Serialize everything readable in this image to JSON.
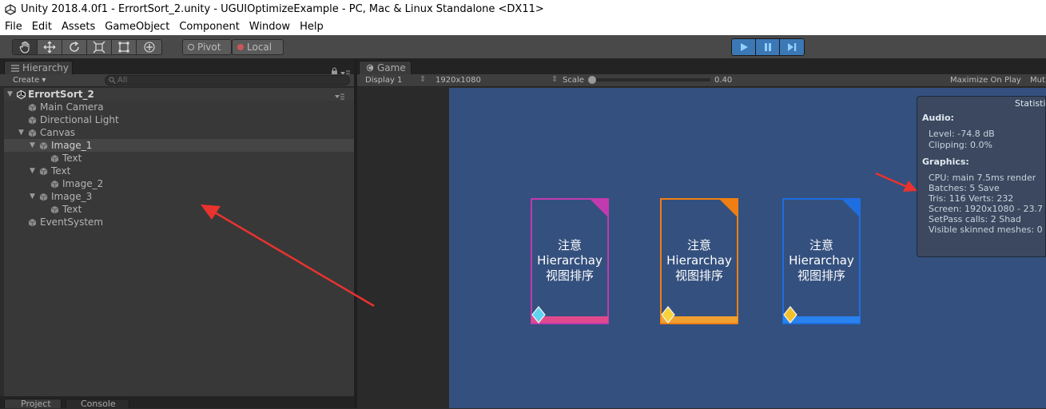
{
  "window": {
    "title": "Unity 2018.4.0f1 - ErrortSort_2.unity - UGUIOptimizeExample - PC, Mac & Linux Standalone <DX11>"
  },
  "menu": [
    "File",
    "Edit",
    "Assets",
    "GameObject",
    "Component",
    "Window",
    "Help"
  ],
  "toolbar": {
    "pivot_label": "Pivot",
    "local_label": "Local"
  },
  "hierarchy": {
    "tab_label": "Hierarchy",
    "create_label": "Create ▾",
    "search_placeholder": "All",
    "scene_name": "ErrortSort_2",
    "items": [
      {
        "label": "Main Camera"
      },
      {
        "label": "Directional Light"
      },
      {
        "label": "Canvas"
      },
      {
        "label": "Image_1"
      },
      {
        "label": "Text"
      },
      {
        "label": "Text"
      },
      {
        "label": "Image_2"
      },
      {
        "label": "Image_3"
      },
      {
        "label": "Text"
      },
      {
        "label": "EventSystem"
      }
    ],
    "bottom_tabs": [
      "Project",
      "Console"
    ]
  },
  "game": {
    "tab_label": "Game",
    "display": "Display 1",
    "resolution": "1920x1080",
    "scale_label": "Scale",
    "scale_value": "0.40",
    "maximize_label": "Maximize On Play",
    "mute_label": "Mut"
  },
  "cards": [
    {
      "line1": "注意",
      "line2": "Hierarchay",
      "line3": "视图排序",
      "accent": "#c23ab0",
      "bottom": "#e04a8c"
    },
    {
      "line1": "注意",
      "line2": "Hierarchay",
      "line3": "视图排序",
      "accent": "#f07f13",
      "bottom": "#f0a030"
    },
    {
      "line1": "注意",
      "line2": "Hierarchay",
      "line3": "视图排序",
      "accent": "#1e6ee0",
      "bottom": "#2a82ee"
    }
  ],
  "stats": {
    "title": "Statisti",
    "audio_header": "Audio:",
    "level": "Level: -74.8 dB",
    "clipping": "Clipping: 0.0%",
    "graphics_header": "Graphics:",
    "cpu": "CPU: main 7.5ms  render",
    "batches": "Batches: 5        Save",
    "tris": "Tris: 116  Verts: 232",
    "screen": "Screen: 1920x1080 - 23.7",
    "setpass": "SetPass calls: 2      Shad",
    "skinned": "Visible skinned meshes: 0"
  }
}
